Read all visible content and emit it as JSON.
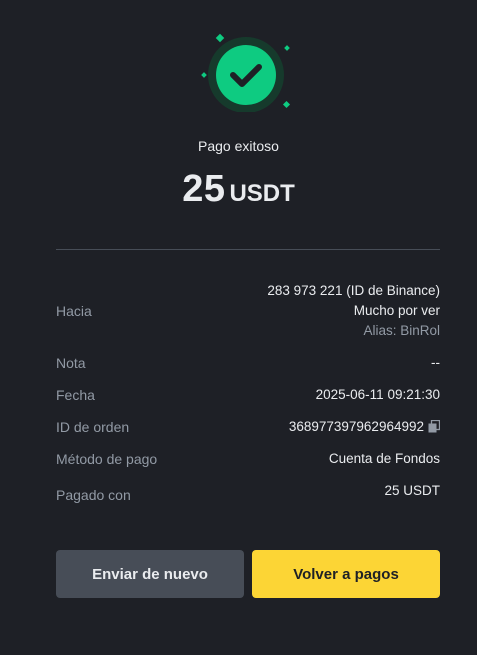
{
  "status": {
    "title": "Pago exitoso",
    "icon": "check-icon"
  },
  "amount": {
    "value": "25",
    "currency": "USDT"
  },
  "details": {
    "to": {
      "label": "Hacia",
      "id_line": "283 973 221 (ID de Binance)",
      "name": "Mucho por ver",
      "alias": "Alias: BinRol"
    },
    "note": {
      "label": "Nota",
      "value": "--"
    },
    "date": {
      "label": "Fecha",
      "value": "2025-06-11 09:21:30"
    },
    "order_id": {
      "label": "ID de orden",
      "value": "368977397962964992"
    },
    "payment_method": {
      "label": "Método de pago",
      "value": "Cuenta de Fondos"
    },
    "paid_with": {
      "label": "Pagado con",
      "value": "25 USDT"
    }
  },
  "actions": {
    "send_again_label": "Enviar de nuevo",
    "back_to_payments_label": "Volver a pagos"
  },
  "colors": {
    "background": "#1e2026",
    "success_green": "#0ecb81",
    "primary_yellow": "#fcd535",
    "secondary_button": "#474d57",
    "muted_text": "#929aa5"
  }
}
